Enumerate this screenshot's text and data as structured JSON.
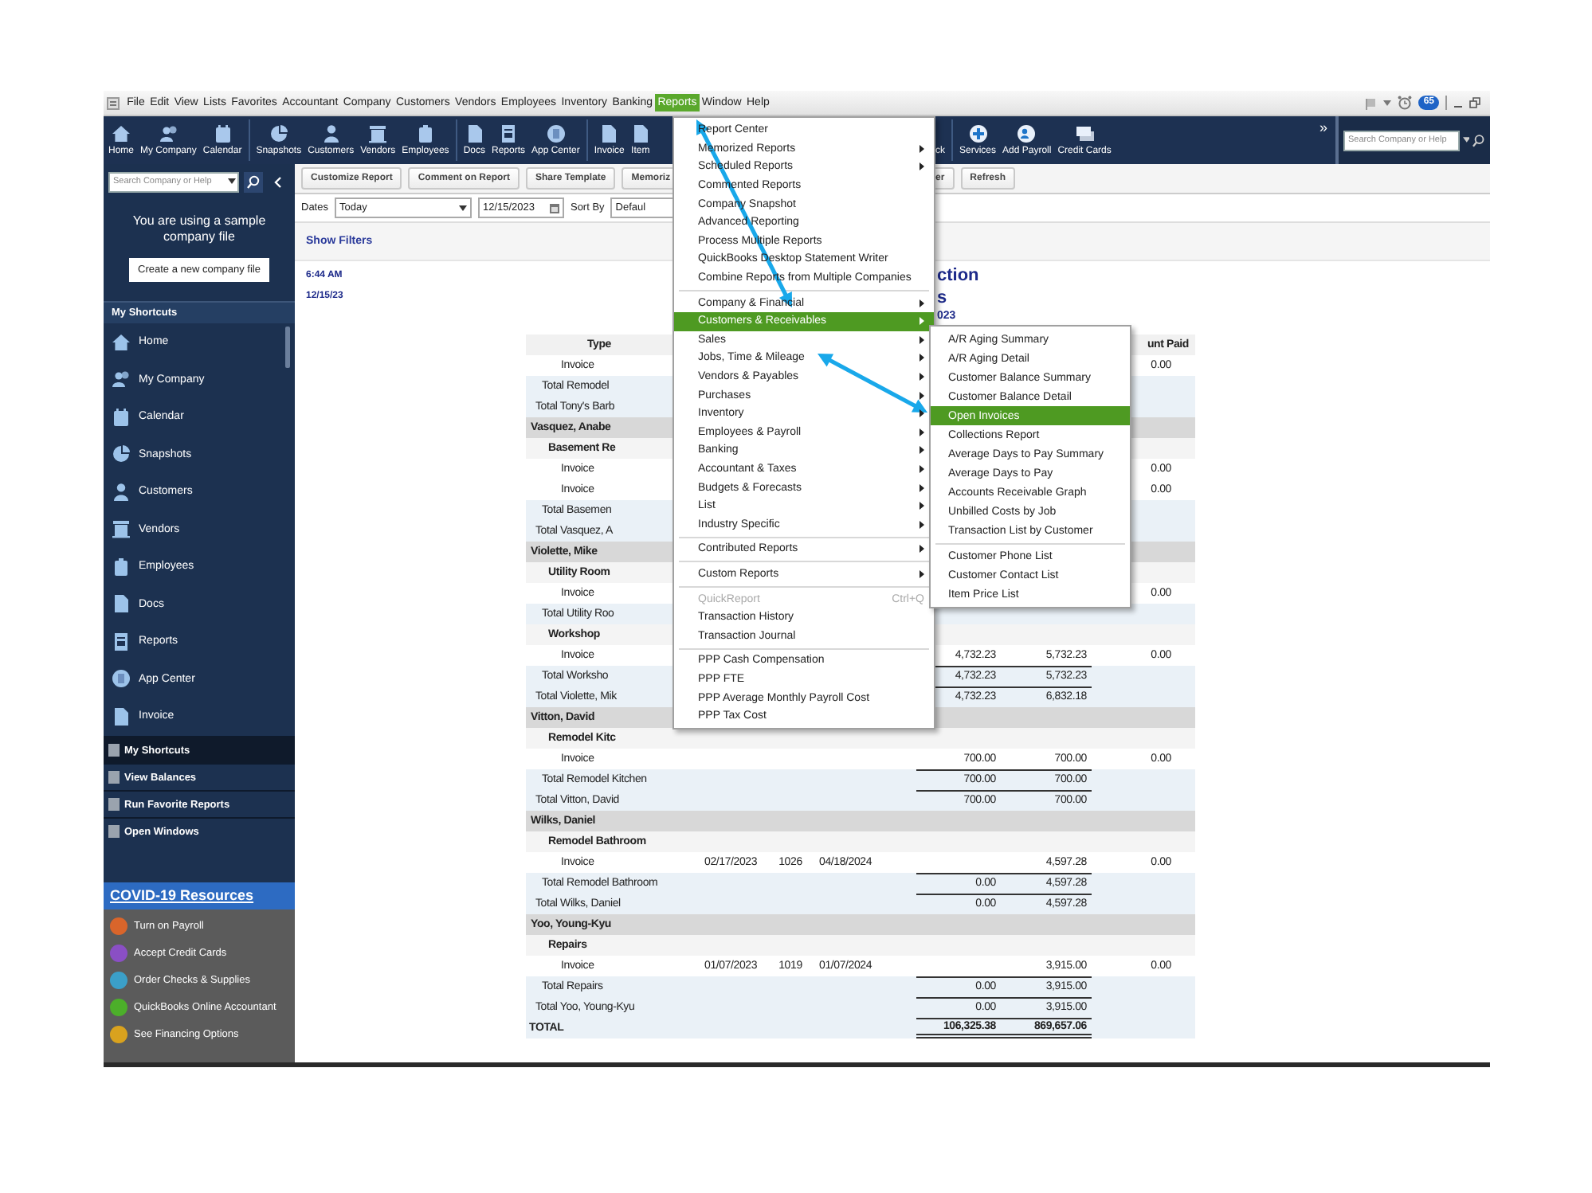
{
  "menubar": {
    "items": [
      {
        "label": "File",
        "selected": false
      },
      {
        "label": "Edit",
        "selected": false
      },
      {
        "label": "View",
        "selected": false
      },
      {
        "label": "Lists",
        "selected": false
      },
      {
        "label": "Favorites",
        "selected": false
      },
      {
        "label": "Accountant",
        "selected": false
      },
      {
        "label": "Company",
        "selected": false
      },
      {
        "label": "Customers",
        "selected": false
      },
      {
        "label": "Vendors",
        "selected": false
      },
      {
        "label": "Employees",
        "selected": false
      },
      {
        "label": "Inventory",
        "selected": false
      },
      {
        "label": "Banking",
        "selected": false
      },
      {
        "label": "Reports",
        "selected": true
      },
      {
        "label": "Window",
        "selected": false
      },
      {
        "label": "Help",
        "selected": false
      }
    ],
    "alert_count": "65"
  },
  "toolbar": {
    "buttons": [
      {
        "label": "Home"
      },
      {
        "label": "My Company"
      },
      {
        "label": "Calendar"
      },
      {
        "label": "Snapshots"
      },
      {
        "label": "Customers"
      },
      {
        "label": "Vendors"
      },
      {
        "label": "Employees"
      },
      {
        "label": "Docs"
      },
      {
        "label": "Reports"
      },
      {
        "label": "App Center"
      },
      {
        "label": "Invoice"
      },
      {
        "label": "Item"
      }
    ],
    "right_buttons": [
      {
        "label": "ck"
      },
      {
        "label": "Services"
      },
      {
        "label": "Add Payroll"
      },
      {
        "label": "Credit Cards"
      }
    ],
    "more": "»",
    "search": {
      "placeholder": "Search Company or Help"
    }
  },
  "sidebar": {
    "search": {
      "placeholder": "Search Company or Help"
    },
    "sample_notice": "You are using a sample company file",
    "create_button": "Create a new company file",
    "shortcuts_title": "My Shortcuts",
    "shortcuts": [
      {
        "label": "Home"
      },
      {
        "label": "My Company"
      },
      {
        "label": "Calendar"
      },
      {
        "label": "Snapshots"
      },
      {
        "label": "Customers"
      },
      {
        "label": "Vendors"
      },
      {
        "label": "Employees"
      },
      {
        "label": "Docs"
      },
      {
        "label": "Reports"
      },
      {
        "label": "App Center"
      },
      {
        "label": "Invoice"
      }
    ],
    "nav": [
      {
        "label": "My Shortcuts",
        "selected": true
      },
      {
        "label": "View Balances",
        "selected": false
      },
      {
        "label": "Run Favorite Reports",
        "selected": false
      },
      {
        "label": "Open Windows",
        "selected": false
      }
    ],
    "resources": {
      "title": "COVID-19 Resources",
      "items": [
        {
          "label": "Turn on Payroll",
          "color": "#d9652b"
        },
        {
          "label": "Accept Credit Cards",
          "color": "#8a4fc4"
        },
        {
          "label": "Order Checks & Supplies",
          "color": "#3b9fc8"
        },
        {
          "label": "QuickBooks Online Accountant",
          "color": "#4caf2a"
        },
        {
          "label": "See Financing Options",
          "color": "#d9a21e"
        }
      ]
    }
  },
  "report": {
    "buttons": [
      "Customize Report",
      "Comment on Report",
      "Share Template",
      "Memoriz"
    ],
    "buttons_right": [
      "er",
      "Refresh"
    ],
    "dates_label": "Dates",
    "dates_value": "Today",
    "date": "12/15/2023",
    "sort_label": "Sort By",
    "sort_value": "Defaul",
    "show_filters": "Show Filters",
    "time": "6:44 AM",
    "print_date": "12/15/23",
    "title_fragments": [
      "ction",
      "s",
      "023"
    ],
    "columns": {
      "type": "Type",
      "column_7": "unt Paid"
    },
    "rows": [
      {
        "kind": "txn",
        "type": "Invoice",
        "column_7": "0.00"
      },
      {
        "kind": "job_total",
        "type": "Total Remodel"
      },
      {
        "kind": "customer_total",
        "type": "Total Tony's Barb"
      },
      {
        "kind": "customer",
        "type": "Vasquez, Anabe"
      },
      {
        "kind": "job",
        "type": "Basement Re"
      },
      {
        "kind": "txn",
        "type": "Invoice",
        "column_7": "0.00"
      },
      {
        "kind": "txn",
        "type": "Invoice",
        "column_7": "0.00"
      },
      {
        "kind": "job_total",
        "type": "Total Basemen"
      },
      {
        "kind": "customer_total",
        "type": "Total Vasquez, A"
      },
      {
        "kind": "customer",
        "type": "Violette, Mike"
      },
      {
        "kind": "job",
        "type": "Utility Room"
      },
      {
        "kind": "txn",
        "type": "Invoice",
        "column_7": "0.00"
      },
      {
        "kind": "job_total",
        "type": "Total Utility Roo"
      },
      {
        "kind": "job",
        "type": "Workshop"
      },
      {
        "kind": "txn",
        "type": "Invoice",
        "column_5": "4,732.23",
        "column_6": "5,732.23",
        "column_7": "0.00"
      },
      {
        "kind": "job_total",
        "type": "Total Worksho",
        "column_5": "4,732.23",
        "column_6": "5,732.23"
      },
      {
        "kind": "customer_total",
        "type": "Total Violette, Mik",
        "column_5": "4,732.23",
        "column_6": "6,832.18"
      },
      {
        "kind": "customer",
        "type": "Vitton, David"
      },
      {
        "kind": "job",
        "type": "Remodel Kitc"
      },
      {
        "kind": "txn",
        "type": "Invoice",
        "column_5": "700.00",
        "column_6": "700.00",
        "column_7": "0.00"
      },
      {
        "kind": "job_total",
        "type": "Total Remodel Kitchen",
        "column_5": "700.00",
        "column_6": "700.00"
      },
      {
        "kind": "customer_total",
        "type": "Total Vitton, David",
        "column_5": "700.00",
        "column_6": "700.00"
      },
      {
        "kind": "customer",
        "type": "Wilks, Daniel"
      },
      {
        "kind": "job",
        "type": "Remodel Bathroom"
      },
      {
        "kind": "txn",
        "type": "Invoice",
        "column_2": "02/17/2023",
        "column_3": "1026",
        "column_4": "04/18/2024",
        "column_6": "4,597.28",
        "column_7": "0.00"
      },
      {
        "kind": "job_total",
        "type": "Total Remodel Bathroom",
        "column_5": "0.00",
        "column_6": "4,597.28"
      },
      {
        "kind": "customer_total",
        "type": "Total Wilks, Daniel",
        "column_5": "0.00",
        "column_6": "4,597.28"
      },
      {
        "kind": "customer",
        "type": "Yoo, Young-Kyu"
      },
      {
        "kind": "job",
        "type": "Repairs"
      },
      {
        "kind": "txn",
        "type": "Invoice",
        "column_2": "01/07/2023",
        "column_3": "1019",
        "column_4": "01/07/2024",
        "column_6": "3,915.00",
        "column_7": "0.00"
      },
      {
        "kind": "job_total",
        "type": "Total Repairs",
        "column_5": "0.00",
        "column_6": "3,915.00"
      },
      {
        "kind": "customer_total",
        "type": "Total Yoo, Young-Kyu",
        "column_5": "0.00",
        "column_6": "3,915.00"
      },
      {
        "kind": "grand_total",
        "type": "TOTAL",
        "column_5": "106,325.38",
        "column_6": "869,657.06"
      }
    ]
  },
  "reports_menu": {
    "items": [
      {
        "kind": "item",
        "label": "Report Center",
        "submenu": false,
        "selected": false,
        "disabled": false
      },
      {
        "kind": "item",
        "label": "Memorized Reports",
        "submenu": true,
        "selected": false,
        "disabled": false
      },
      {
        "kind": "item",
        "label": "Scheduled Reports",
        "submenu": true,
        "selected": false,
        "disabled": false
      },
      {
        "kind": "item",
        "label": "Commented Reports",
        "submenu": false,
        "selected": false,
        "disabled": false
      },
      {
        "kind": "item",
        "label": "Company Snapshot",
        "submenu": false,
        "selected": false,
        "disabled": false
      },
      {
        "kind": "item",
        "label": "Advanced Reporting",
        "submenu": false,
        "selected": false,
        "disabled": false
      },
      {
        "kind": "item",
        "label": "Process Multiple Reports",
        "submenu": false,
        "selected": false,
        "disabled": false
      },
      {
        "kind": "item",
        "label": "QuickBooks Desktop Statement Writer",
        "submenu": false,
        "selected": false,
        "disabled": false
      },
      {
        "kind": "item",
        "label": "Combine Reports from Multiple Companies",
        "submenu": false,
        "selected": false,
        "disabled": false
      },
      {
        "kind": "separator"
      },
      {
        "kind": "item",
        "label": "Company & Financial",
        "submenu": true,
        "selected": false,
        "disabled": false
      },
      {
        "kind": "item",
        "label": "Customers & Receivables",
        "submenu": true,
        "selected": true,
        "disabled": false
      },
      {
        "kind": "item",
        "label": "Sales",
        "submenu": true,
        "selected": false,
        "disabled": false
      },
      {
        "kind": "item",
        "label": "Jobs, Time & Mileage",
        "submenu": true,
        "selected": false,
        "disabled": false
      },
      {
        "kind": "item",
        "label": "Vendors & Payables",
        "submenu": true,
        "selected": false,
        "disabled": false
      },
      {
        "kind": "item",
        "label": "Purchases",
        "submenu": true,
        "selected": false,
        "disabled": false
      },
      {
        "kind": "item",
        "label": "Inventory",
        "submenu": true,
        "selected": false,
        "disabled": false
      },
      {
        "kind": "item",
        "label": "Employees & Payroll",
        "submenu": true,
        "selected": false,
        "disabled": false
      },
      {
        "kind": "item",
        "label": "Banking",
        "submenu": true,
        "selected": false,
        "disabled": false
      },
      {
        "kind": "item",
        "label": "Accountant & Taxes",
        "submenu": true,
        "selected": false,
        "disabled": false
      },
      {
        "kind": "item",
        "label": "Budgets & Forecasts",
        "submenu": true,
        "selected": false,
        "disabled": false
      },
      {
        "kind": "item",
        "label": "List",
        "submenu": true,
        "selected": false,
        "disabled": false
      },
      {
        "kind": "item",
        "label": "Industry Specific",
        "submenu": true,
        "selected": false,
        "disabled": false
      },
      {
        "kind": "separator"
      },
      {
        "kind": "item",
        "label": "Contributed Reports",
        "submenu": true,
        "selected": false,
        "disabled": false
      },
      {
        "kind": "separator"
      },
      {
        "kind": "item",
        "label": "Custom Reports",
        "submenu": true,
        "selected": false,
        "disabled": false
      },
      {
        "kind": "separator"
      },
      {
        "kind": "item",
        "label": "QuickReport",
        "shortcut": "Ctrl+Q",
        "submenu": false,
        "selected": false,
        "disabled": true
      },
      {
        "kind": "item",
        "label": "Transaction History",
        "submenu": false,
        "selected": false,
        "disabled": false
      },
      {
        "kind": "item",
        "label": "Transaction Journal",
        "submenu": false,
        "selected": false,
        "disabled": false
      },
      {
        "kind": "separator"
      },
      {
        "kind": "item",
        "label": "PPP Cash Compensation",
        "submenu": false,
        "selected": false,
        "disabled": false
      },
      {
        "kind": "item",
        "label": "PPP FTE",
        "submenu": false,
        "selected": false,
        "disabled": false
      },
      {
        "kind": "item",
        "label": "PPP Average Monthly Payroll Cost",
        "submenu": false,
        "selected": false,
        "disabled": false
      },
      {
        "kind": "item",
        "label": "PPP Tax Cost",
        "submenu": false,
        "selected": false,
        "disabled": false
      }
    ]
  },
  "submenu": {
    "items": [
      {
        "kind": "item",
        "label": "A/R Aging Summary",
        "selected": false
      },
      {
        "kind": "item",
        "label": "A/R Aging Detail",
        "selected": false
      },
      {
        "kind": "item",
        "label": "Customer Balance Summary",
        "selected": false
      },
      {
        "kind": "item",
        "label": "Customer Balance Detail",
        "selected": false
      },
      {
        "kind": "item",
        "label": "Open Invoices",
        "selected": true
      },
      {
        "kind": "item",
        "label": "Collections Report",
        "selected": false
      },
      {
        "kind": "item",
        "label": "Average Days to Pay Summary",
        "selected": false
      },
      {
        "kind": "item",
        "label": "Average Days to Pay",
        "selected": false
      },
      {
        "kind": "item",
        "label": "Accounts Receivable Graph",
        "selected": false
      },
      {
        "kind": "item",
        "label": "Unbilled Costs by Job",
        "selected": false
      },
      {
        "kind": "item",
        "label": "Transaction List by Customer",
        "selected": false
      },
      {
        "kind": "separator"
      },
      {
        "kind": "item",
        "label": "Customer Phone List",
        "selected": false
      },
      {
        "kind": "item",
        "label": "Customer Contact List",
        "selected": false
      },
      {
        "kind": "item",
        "label": "Item Price List",
        "selected": false
      }
    ]
  }
}
